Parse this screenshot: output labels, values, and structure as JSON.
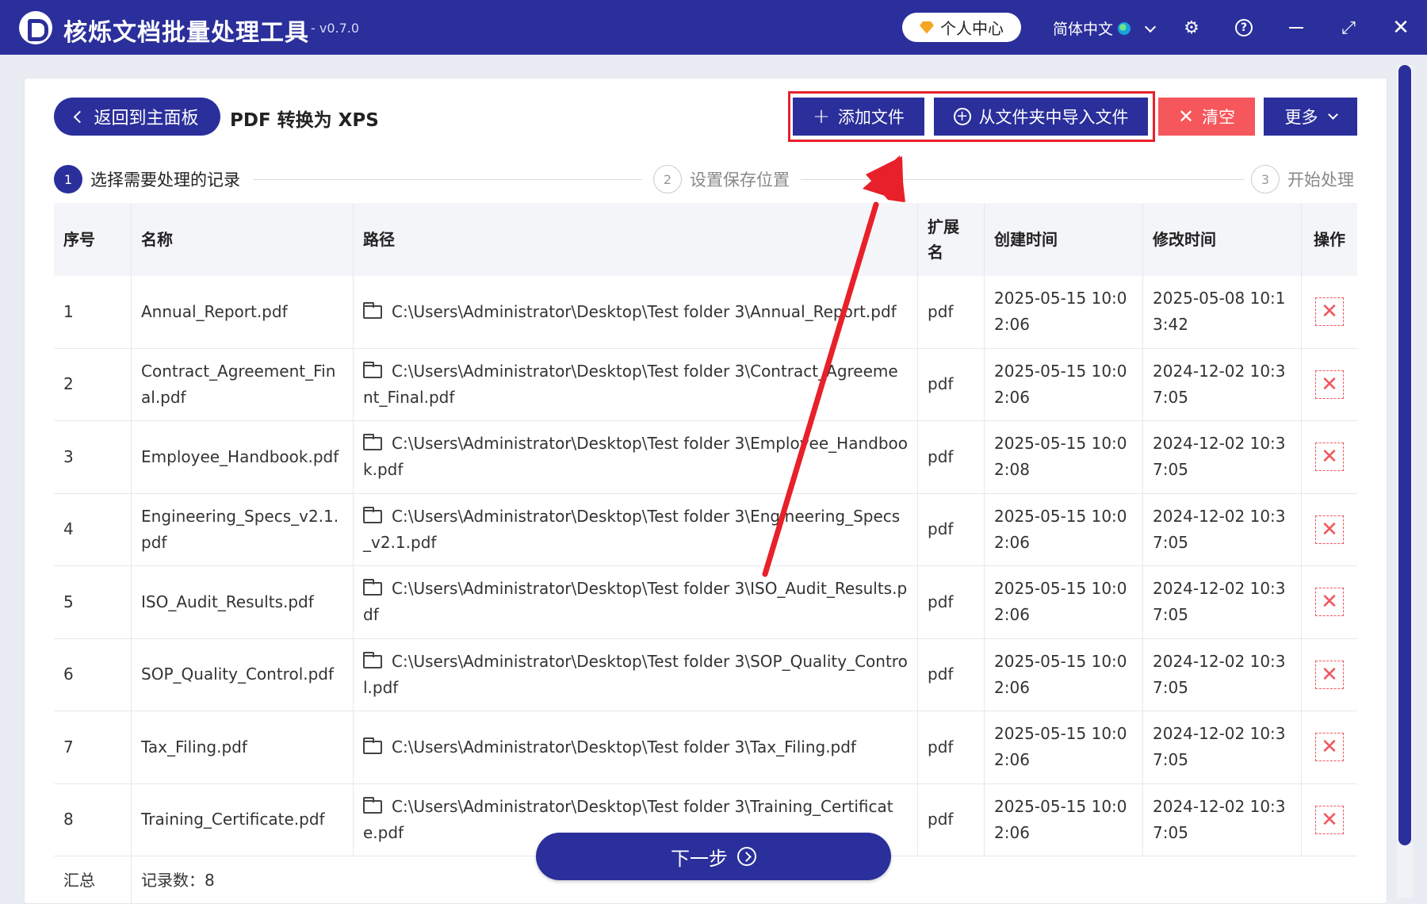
{
  "app": {
    "title": "核烁文档批量处理工具",
    "version": "- v0.7.0",
    "user_center": "个人中心",
    "language": "简体中文"
  },
  "toolbar": {
    "back_label": "返回到主面板",
    "page_title": "PDF 转换为 XPS",
    "add_file_label": "添加文件",
    "import_folder_label": "从文件夹中导入文件",
    "clear_label": "清空",
    "more_label": "更多"
  },
  "steps": [
    {
      "num": "1",
      "label": "选择需要处理的记录"
    },
    {
      "num": "2",
      "label": "设置保存位置"
    },
    {
      "num": "3",
      "label": "开始处理"
    }
  ],
  "table": {
    "headers": {
      "seq": "序号",
      "name": "名称",
      "path": "路径",
      "ext": "扩展名",
      "ctime": "创建时间",
      "mtime": "修改时间",
      "op": "操作"
    },
    "rows": [
      {
        "seq": "1",
        "name": "Annual_Report.pdf",
        "path": "C:\\Users\\Administrator\\Desktop\\Test folder 3\\Annual_Report.pdf",
        "ext": "pdf",
        "ctime": "2025-05-15 10:02:06",
        "mtime": "2025-05-08 10:13:42"
      },
      {
        "seq": "2",
        "name": "Contract_Agreement_Final.pdf",
        "path": "C:\\Users\\Administrator\\Desktop\\Test folder 3\\Contract_Agreement_Final.pdf",
        "ext": "pdf",
        "ctime": "2025-05-15 10:02:06",
        "mtime": "2024-12-02 10:37:05"
      },
      {
        "seq": "3",
        "name": "Employee_Handbook.pdf",
        "path": "C:\\Users\\Administrator\\Desktop\\Test folder 3\\Employee_Handbook.pdf",
        "ext": "pdf",
        "ctime": "2025-05-15 10:02:08",
        "mtime": "2024-12-02 10:37:05"
      },
      {
        "seq": "4",
        "name": "Engineering_Specs_v2.1.pdf",
        "path": "C:\\Users\\Administrator\\Desktop\\Test folder 3\\Engineering_Specs_v2.1.pdf",
        "ext": "pdf",
        "ctime": "2025-05-15 10:02:06",
        "mtime": "2024-12-02 10:37:05"
      },
      {
        "seq": "5",
        "name": "ISO_Audit_Results.pdf",
        "path": "C:\\Users\\Administrator\\Desktop\\Test folder 3\\ISO_Audit_Results.pdf",
        "ext": "pdf",
        "ctime": "2025-05-15 10:02:06",
        "mtime": "2024-12-02 10:37:05"
      },
      {
        "seq": "6",
        "name": "SOP_Quality_Control.pdf",
        "path": "C:\\Users\\Administrator\\Desktop\\Test folder 3\\SOP_Quality_Control.pdf",
        "ext": "pdf",
        "ctime": "2025-05-15 10:02:06",
        "mtime": "2024-12-02 10:37:05"
      },
      {
        "seq": "7",
        "name": "Tax_Filing.pdf",
        "path": "C:\\Users\\Administrator\\Desktop\\Test folder 3\\Tax_Filing.pdf",
        "ext": "pdf",
        "ctime": "2025-05-15 10:02:06",
        "mtime": "2024-12-02 10:37:05"
      },
      {
        "seq": "8",
        "name": "Training_Certificate.pdf",
        "path": "C:\\Users\\Administrator\\Desktop\\Test folder 3\\Training_Certificate.pdf",
        "ext": "pdf",
        "ctime": "2025-05-15 10:02:06",
        "mtime": "2024-12-02 10:37:05"
      }
    ],
    "summary_label": "汇总",
    "record_count": "记录数：8"
  },
  "next_label": "下一步",
  "colors": {
    "brand": "#2b2f9b",
    "danger": "#f5575c",
    "annotation": "#e8202a"
  },
  "icons": {
    "add": "plus-icon",
    "import": "circle-plus-icon",
    "clear": "close-icon",
    "folder": "folder-icon",
    "delete": "delete-x-icon"
  }
}
